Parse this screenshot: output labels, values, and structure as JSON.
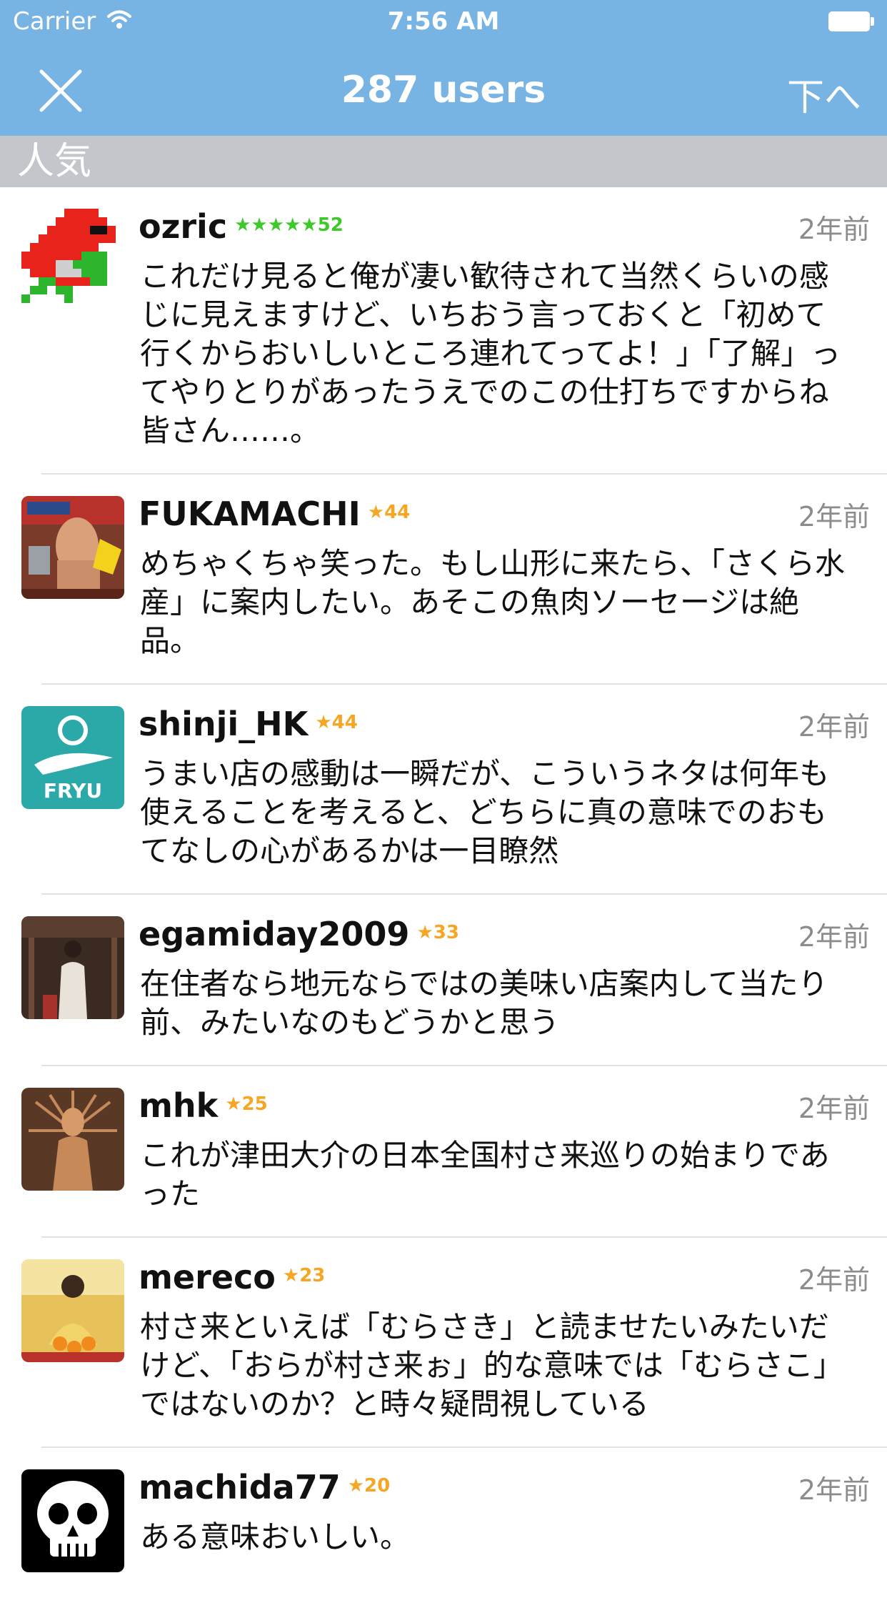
{
  "status_bar": {
    "carrier": "Carrier",
    "time": "7:56 AM",
    "wifi_icon": "wifi-icon",
    "battery_icon": "battery-icon"
  },
  "nav": {
    "title": "287 users",
    "close_icon": "close-icon",
    "right_button": "下へ",
    "right_icon": "chevron-down-icon",
    "background_color": "#77b3e3"
  },
  "section": {
    "title": "人気",
    "background_color": "#c3c7cc"
  },
  "colors": {
    "star_green": "#3ec92a",
    "star_orange": "#f5a623",
    "time_gray": "#8c8c8c"
  },
  "comments": [
    {
      "username": "ozric",
      "stars": "★★★★★52",
      "star_color": "#3ec92a",
      "time": "2年前",
      "text": "これだけ見ると俺が凄い歓待されて当然くらいの感じに見えますけど、いちおう言っておくと「初めて行くからおいしいところ連れてってよ！」「了解」ってやりとりがあったうえでのこの仕打ちですからね皆さん……。"
    },
    {
      "username": "FUKAMACHI",
      "stars": "★44",
      "star_color": "#f5a623",
      "time": "2年前",
      "text": "めちゃくちゃ笑った。もし山形に来たら、「さくら水産」に案内したい。あそこの魚肉ソーセージは絶品。"
    },
    {
      "username": "shinji_HK",
      "stars": "★44",
      "star_color": "#f5a623",
      "time": "2年前",
      "text": "うまい店の感動は一瞬だが、こういうネタは何年も使えることを考えると、どちらに真の意味でのおもてなしの心があるかは一目瞭然"
    },
    {
      "username": "egamiday2009",
      "stars": "★33",
      "star_color": "#f5a623",
      "time": "2年前",
      "text": "在住者なら地元ならではの美味い店案内して当たり前、みたいなのもどうかと思う"
    },
    {
      "username": "mhk",
      "stars": "★25",
      "star_color": "#f5a623",
      "time": "2年前",
      "text": "これが津田大介の日本全国村さ来巡りの始まりであった"
    },
    {
      "username": "mereco",
      "stars": "★23",
      "star_color": "#f5a623",
      "time": "2年前",
      "text": "村さ来といえば「むらさき」と読ませたいみたいだけど、「おらが村さ来ぉ」的な意味では「むらさこ」ではないのか？と時々疑問視している"
    },
    {
      "username": "machida77",
      "stars": "★20",
      "star_color": "#f5a623",
      "time": "2年前",
      "text": "ある意味おいしい。"
    }
  ],
  "avatar_texts": {
    "shinji_logo": "FRYU"
  }
}
